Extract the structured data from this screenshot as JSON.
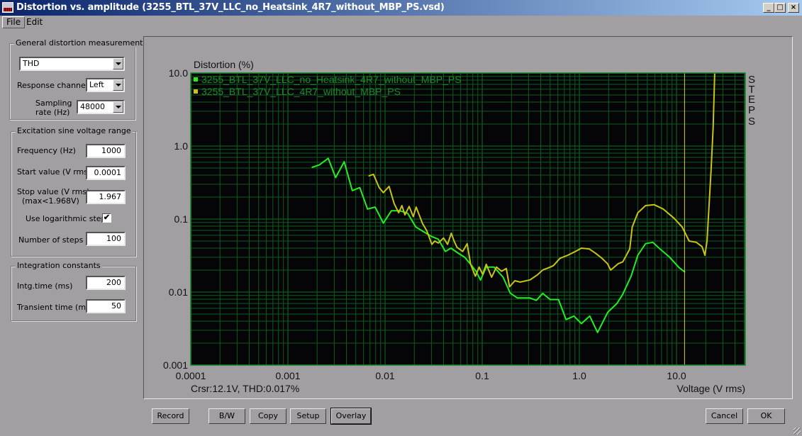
{
  "window": {
    "title": "Distortion vs. amplitude (3255_BTL_37V_LLC_no_Heatsink_4R7_without_MBP_PS.vsd)",
    "controls": {
      "minimize": "_",
      "maximize": "□",
      "close": "×"
    }
  },
  "menu": {
    "items": [
      "File",
      "Edit"
    ]
  },
  "left_panel": {
    "general": {
      "title": "General distortion measurement",
      "measurement_type": "THD",
      "response_channel_label": "Response channel",
      "response_channel": "Left",
      "sampling_rate_label_1": "Sampling",
      "sampling_rate_label_2": "rate (Hz)",
      "sampling_rate": "48000"
    },
    "excitation": {
      "title": "Excitation sine voltage range",
      "frequency_label": "Frequency (Hz)",
      "frequency": "1000",
      "start_label": "Start value (V rms)",
      "start": "0.0001",
      "stop_label_1": "Stop value (V rms)",
      "stop_label_2": "(max<1.968V)",
      "stop": "1.967",
      "log_steps_label": "Use logarithmic steps",
      "log_steps_checked": true,
      "log_steps_mark": "✔",
      "steps_label": "Number of steps",
      "steps": "100"
    },
    "integration": {
      "title": "Integration constants",
      "intg_time_label": "Intg.time (ms)",
      "intg_time": "200",
      "transient_label": "Transient time (ms)",
      "transient": "50"
    }
  },
  "plot": {
    "cursor_readout": "Crsr:12.1V, THD:0.017%",
    "steps_label": [
      "S",
      "T",
      "E",
      "P",
      "S"
    ],
    "colors": {
      "background": "#050508",
      "grid": "#0f5a1e",
      "frame": "#1a8a2a",
      "series1": "#22ee22",
      "series2": "#c8c414",
      "cursor": "#d8d020",
      "legend_text": "#1a8a2a"
    }
  },
  "chart_data": {
    "type": "line",
    "title": "",
    "ylabel": "Distortion (%)",
    "xlabel": "Voltage (V rms)",
    "xscale": "log",
    "yscale": "log",
    "xlim": [
      0.0001,
      51
    ],
    "ylim": [
      0.001,
      10
    ],
    "grid": true,
    "legend_position": "top-left",
    "x_ticks": [
      "0.0001",
      "0.001",
      "0.01",
      "0.1",
      "1.0",
      "10.0"
    ],
    "x_tick_values": [
      0.0001,
      0.001,
      0.01,
      0.1,
      1,
      10
    ],
    "y_ticks": [
      "10.0",
      "1.0",
      "0.1",
      "0.01",
      "0.001"
    ],
    "y_tick_values": [
      10,
      1,
      0.1,
      0.01,
      0.001
    ],
    "cursor_x": 12.1,
    "series": [
      {
        "name": "3255_BTL_37V_LLC_no_Heatsink_4R7_without_MBP_PS",
        "color": "#22ee22",
        "x": [
          0.00177,
          0.0021,
          0.0026,
          0.0031,
          0.0038,
          0.0046,
          0.0055,
          0.0066,
          0.0079,
          0.0096,
          0.0116,
          0.0142,
          0.0171,
          0.0207,
          0.0249,
          0.03,
          0.0353,
          0.0418,
          0.0477,
          0.055,
          0.066,
          0.076,
          0.087,
          0.096,
          0.11,
          0.132,
          0.164,
          0.194,
          0.23,
          0.31,
          0.36,
          0.42,
          0.5,
          0.61,
          0.73,
          0.88,
          1.05,
          1.28,
          1.54,
          1.96,
          2.44,
          2.78,
          3.4,
          4.0,
          4.8,
          5.7,
          6.9,
          8.5,
          10.6,
          12.2
        ],
        "y": [
          0.51,
          0.55,
          0.68,
          0.37,
          0.61,
          0.245,
          0.27,
          0.137,
          0.146,
          0.088,
          0.13,
          0.13,
          0.12,
          0.078,
          0.067,
          0.058,
          0.053,
          0.036,
          0.04,
          0.035,
          0.03,
          0.024,
          0.019,
          0.0146,
          0.022,
          0.022,
          0.016,
          0.0097,
          0.0083,
          0.0083,
          0.0077,
          0.0096,
          0.0079,
          0.0079,
          0.0042,
          0.0047,
          0.0037,
          0.0047,
          0.0028,
          0.0053,
          0.007,
          0.0092,
          0.0164,
          0.032,
          0.046,
          0.048,
          0.038,
          0.03,
          0.0217,
          0.0188
        ]
      },
      {
        "name": "3255_BTL_37V_LLC_4R7_without_MBP_PS",
        "color": "#c8c414",
        "x": [
          0.0068,
          0.0076,
          0.0087,
          0.0096,
          0.011,
          0.0124,
          0.0138,
          0.0149,
          0.016,
          0.0177,
          0.0195,
          0.0209,
          0.0242,
          0.0269,
          0.0303,
          0.0324,
          0.0353,
          0.04,
          0.044,
          0.048,
          0.051,
          0.055,
          0.063,
          0.07,
          0.076,
          0.085,
          0.093,
          0.101,
          0.11,
          0.125,
          0.14,
          0.158,
          0.177,
          0.191,
          0.217,
          0.246,
          0.31,
          0.37,
          0.42,
          0.48,
          0.54,
          0.63,
          0.76,
          0.91,
          1.05,
          1.26,
          1.47,
          1.71,
          1.95,
          2.1,
          2.5,
          2.8,
          3.3,
          3.5,
          4.0,
          4.8,
          5.9,
          7.3,
          9.4,
          11.4,
          13.5,
          16.0,
          18.3,
          19.6,
          20.6,
          21.6,
          22.7,
          23.8,
          24.7
        ],
        "y": [
          0.39,
          0.41,
          0.27,
          0.23,
          0.28,
          0.163,
          0.122,
          0.153,
          0.114,
          0.149,
          0.108,
          0.146,
          0.088,
          0.069,
          0.045,
          0.05,
          0.047,
          0.055,
          0.045,
          0.064,
          0.051,
          0.041,
          0.036,
          0.046,
          0.024,
          0.0165,
          0.022,
          0.0175,
          0.024,
          0.016,
          0.022,
          0.0193,
          0.021,
          0.0118,
          0.0143,
          0.0137,
          0.0147,
          0.0172,
          0.0201,
          0.0215,
          0.023,
          0.029,
          0.032,
          0.036,
          0.04,
          0.039,
          0.034,
          0.029,
          0.0244,
          0.02,
          0.0244,
          0.026,
          0.039,
          0.078,
          0.122,
          0.153,
          0.157,
          0.137,
          0.103,
          0.078,
          0.05,
          0.048,
          0.042,
          0.032,
          0.05,
          0.152,
          0.47,
          1.8,
          10.0
        ]
      }
    ]
  },
  "buttons": {
    "record": "Record",
    "bw": "B/W",
    "copy": "Copy",
    "setup": "Setup",
    "overlay": "Overlay",
    "cancel": "Cancel",
    "ok": "OK"
  }
}
